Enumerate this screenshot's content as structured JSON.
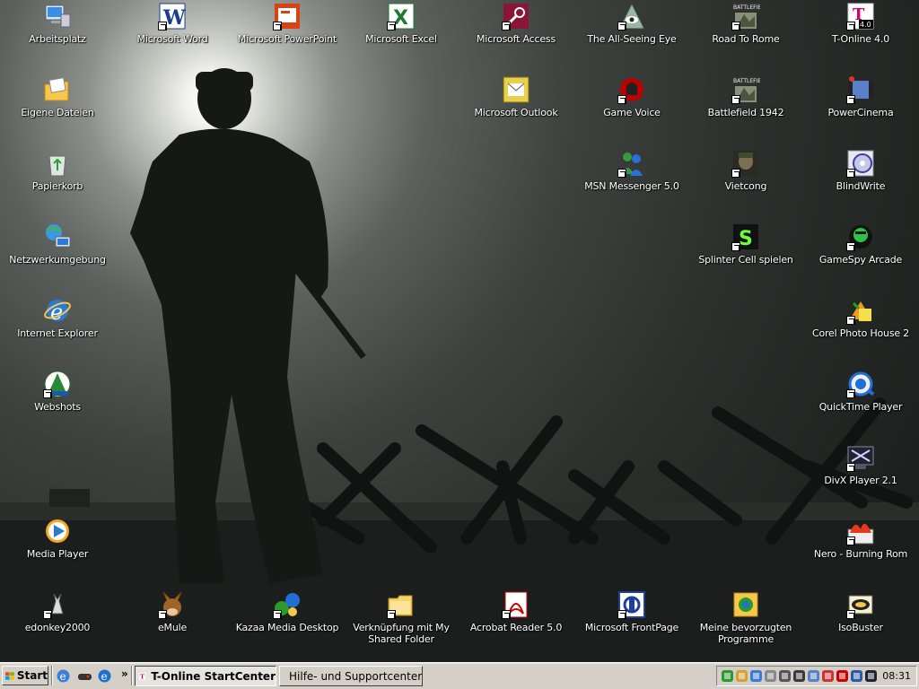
{
  "desktop": {
    "icons": [
      {
        "id": "arbeitsplatz",
        "label": "Arbeitsplatz",
        "icon": "computer-icon",
        "shortcut": false
      },
      {
        "id": "word",
        "label": "Microsoft Word",
        "icon": "word-icon",
        "shortcut": true
      },
      {
        "id": "powerpoint",
        "label": "Microsoft PowerPoint",
        "icon": "powerpoint-icon",
        "shortcut": true
      },
      {
        "id": "excel",
        "label": "Microsoft Excel",
        "icon": "excel-icon",
        "shortcut": true
      },
      {
        "id": "access",
        "label": "Microsoft Access",
        "icon": "access-icon",
        "shortcut": true
      },
      {
        "id": "allseeing",
        "label": "The All-Seeing Eye",
        "icon": "eye-icon",
        "shortcut": true
      },
      {
        "id": "roadtorome",
        "label": "Road To Rome",
        "icon": "battlefield-icon",
        "shortcut": true
      },
      {
        "id": "tonline",
        "label": "T-Online 4.0",
        "icon": "tonline-icon",
        "shortcut": true
      },
      {
        "id": "eigenedateien",
        "label": "Eigene Dateien",
        "icon": "documents-folder-icon",
        "shortcut": false
      },
      {
        "id": "outlook",
        "label": "Microsoft Outlook",
        "icon": "outlook-icon",
        "shortcut": false
      },
      {
        "id": "gamevoice",
        "label": "Game Voice",
        "icon": "gamevoice-icon",
        "shortcut": true
      },
      {
        "id": "bf1942",
        "label": "Battlefield 1942",
        "icon": "battlefield-icon",
        "shortcut": true
      },
      {
        "id": "powercinema",
        "label": "PowerCinema",
        "icon": "film-icon",
        "shortcut": true
      },
      {
        "id": "papierkorb",
        "label": "Papierkorb",
        "icon": "recycle-bin-icon",
        "shortcut": false
      },
      {
        "id": "msn",
        "label": "MSN Messenger 5.0",
        "icon": "messenger-icon",
        "shortcut": true
      },
      {
        "id": "vietcong",
        "label": "Vietcong",
        "icon": "soldier-icon",
        "shortcut": true
      },
      {
        "id": "blindwrite",
        "label": "BlindWrite",
        "icon": "disc-icon",
        "shortcut": true
      },
      {
        "id": "netzwerk",
        "label": "Netzwerkumgebung",
        "icon": "network-icon",
        "shortcut": false
      },
      {
        "id": "splintercell",
        "label": "Splinter Cell spielen",
        "icon": "splintercell-icon",
        "shortcut": true
      },
      {
        "id": "gamespy",
        "label": "GameSpy Arcade",
        "icon": "gamespy-icon",
        "shortcut": true
      },
      {
        "id": "ie",
        "label": "Internet Explorer",
        "icon": "internet-explorer-icon",
        "shortcut": false
      },
      {
        "id": "corel",
        "label": "Corel Photo House 2",
        "icon": "corel-icon",
        "shortcut": true
      },
      {
        "id": "webshots",
        "label": "Webshots",
        "icon": "webshots-icon",
        "shortcut": true
      },
      {
        "id": "quicktime",
        "label": "QuickTime Player",
        "icon": "quicktime-icon",
        "shortcut": true
      },
      {
        "id": "divx",
        "label": "DivX Player 2.1",
        "icon": "divx-icon",
        "shortcut": true
      },
      {
        "id": "mediaplayer",
        "label": "Media Player",
        "icon": "media-player-icon",
        "shortcut": false
      },
      {
        "id": "nero",
        "label": "Nero - Burning Rom",
        "icon": "nero-icon",
        "shortcut": true
      },
      {
        "id": "edonkey",
        "label": "edonkey2000",
        "icon": "donkey-icon",
        "shortcut": true
      },
      {
        "id": "emule",
        "label": "eMule",
        "icon": "mule-icon",
        "shortcut": true
      },
      {
        "id": "kazaa",
        "label": "Kazaa Media Desktop",
        "icon": "kazaa-icon",
        "shortcut": true
      },
      {
        "id": "sharedfolder",
        "label": "Verknüpfung mit My Shared Folder",
        "icon": "folder-icon",
        "shortcut": true
      },
      {
        "id": "acrobat",
        "label": "Acrobat Reader 5.0",
        "icon": "acrobat-icon",
        "shortcut": true
      },
      {
        "id": "frontpage",
        "label": "Microsoft FrontPage",
        "icon": "frontpage-icon",
        "shortcut": true
      },
      {
        "id": "favoriten",
        "label": "Meine bevorzugten Programme",
        "icon": "favorites-icon",
        "shortcut": false
      },
      {
        "id": "isobuster",
        "label": "IsoBuster",
        "icon": "isobuster-icon",
        "shortcut": true
      }
    ]
  },
  "taskbar": {
    "start_label": "Start",
    "quicklaunch": [
      "ie-icon",
      "controller-icon",
      "ie-small-icon"
    ],
    "chevron": "»",
    "tasks": [
      {
        "label": "T-Online StartCenter",
        "icon": "tonline-icon",
        "active": true
      },
      {
        "label": "Hilfe- und Supportcenter",
        "icon": "help-icon",
        "active": false
      }
    ],
    "tray_icons": [
      "network-tray-icon",
      "antivirus-tray-icon",
      "connection-tray-icon",
      "monitor-tray-icon",
      "volume-tray-icon",
      "printer-tray-icon",
      "display-tray-icon",
      "audio-tray-icon",
      "acrobat-tray-icon",
      "screen-tray-icon",
      "media-tray-icon"
    ],
    "clock": "08:31"
  }
}
